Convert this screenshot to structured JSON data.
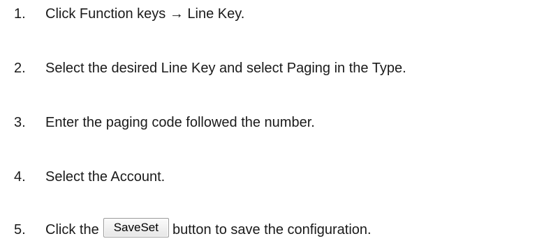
{
  "steps": [
    {
      "number": "1.",
      "text": "Click Function keys → Line Key."
    },
    {
      "number": "2.",
      "text": "Select the desired Line Key and select Paging in the Type."
    },
    {
      "number": "3.",
      "text": "Enter the paging code followed the number."
    },
    {
      "number": "4.",
      "text": "Select the Account."
    },
    {
      "number": "5.",
      "text_before": "Click the",
      "button_label": "SaveSet",
      "text_after": "button to save the configuration."
    }
  ]
}
